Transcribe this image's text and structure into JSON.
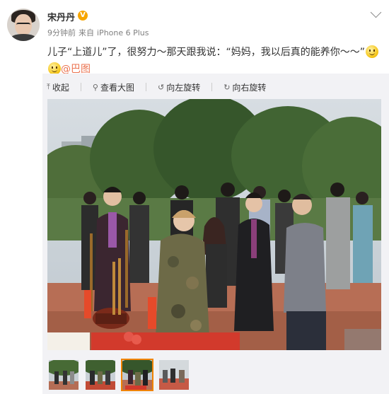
{
  "post": {
    "username": "宋丹丹",
    "verified_badge": "V",
    "time": "9分钟前",
    "source_prefix": "来自",
    "device": "iPhone 6 Plus",
    "text": "儿子“上道儿”了，很努力～那天跟我说：“妈妈，我以后真的能养你～～”",
    "emoji_icons": [
      "smile-emoji-icon",
      "smile-emoji-icon"
    ],
    "mention": "@巴图"
  },
  "toolbar": {
    "collapse_label": "收起",
    "view_large_label": "查看大图",
    "rotate_left_label": "向左旋转",
    "rotate_right_label": "向右旋转"
  },
  "thumbnails": {
    "count": 4,
    "active_index": 2
  },
  "colors": {
    "accent_link": "#eb7350",
    "verified": "#f7a600",
    "active_thumb_border": "#f08300",
    "media_panel_bg": "#f2f2f5"
  }
}
